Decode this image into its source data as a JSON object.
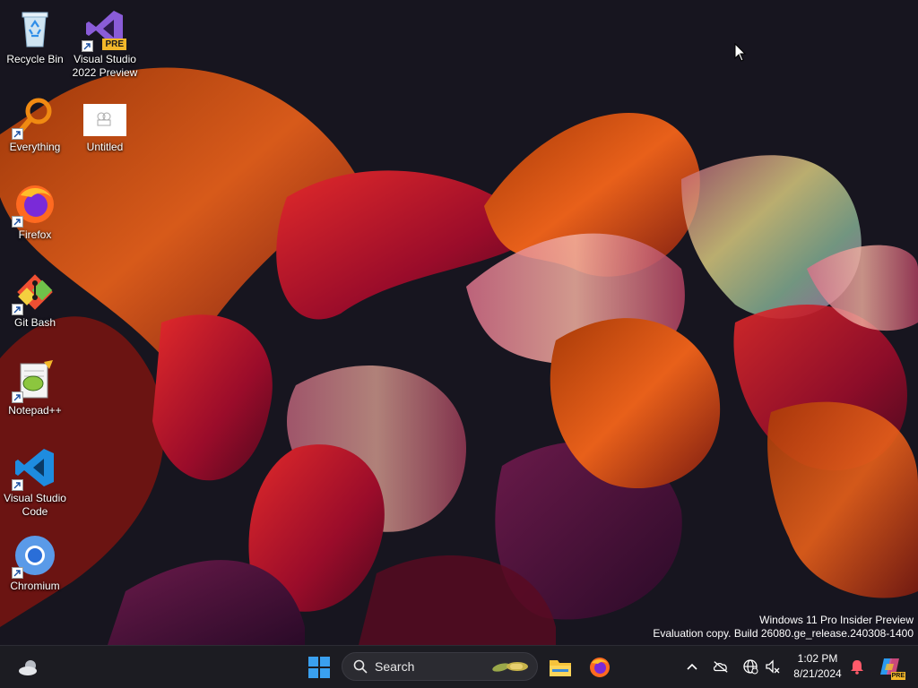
{
  "desktop": {
    "icons": [
      {
        "label": "Recycle Bin"
      },
      {
        "label": "Visual Studio 2022 Preview",
        "badge": "PRE"
      },
      {
        "label": "Everything"
      },
      {
        "label": "Untitled"
      },
      {
        "label": "Firefox"
      },
      {
        "label": "Git Bash"
      },
      {
        "label": "Notepad++"
      },
      {
        "label": "Visual Studio Code"
      },
      {
        "label": "Chromium"
      }
    ],
    "watermark": {
      "line1": "Windows 11 Pro Insider Preview",
      "line2": "Evaluation copy. Build 26080.ge_release.240308-1400"
    }
  },
  "taskbar": {
    "widgets_icon": "weather-cloud-icon",
    "start_icon": "windows-start-icon",
    "search_label": "Search",
    "pinned": [
      "file-explorer-icon",
      "firefox-icon"
    ],
    "tray": {
      "chevron": "show-hidden-icons",
      "icons": [
        "onedrive-offline-icon",
        "network-globe-icon",
        "volume-muted-icon"
      ],
      "time": "1:02 PM",
      "date": "8/21/2024",
      "notification_icon": "bell-icon",
      "copilot_badge": "PRE"
    }
  },
  "colors": {
    "taskbar_bg": "#1c1c22",
    "start_blue": "#3aa0f0",
    "accent_orange": "#e8601a",
    "accent_red": "#c0102c"
  }
}
